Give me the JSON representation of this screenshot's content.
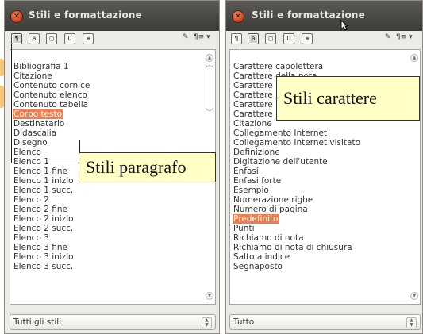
{
  "left_panel": {
    "title": "Stili e formattazione",
    "close_glyph": "×",
    "toolbar_right": "¶≡ ▾",
    "items": [
      "Bibliografia 1",
      "Citazione",
      "Contenuto cornice",
      "Contenuto elenco",
      "Contenuto tabella",
      "Corpo testo",
      "Destinatario",
      "Didascalia",
      "Disegno",
      "Elenco",
      "Elenco 1",
      "Elenco 1 fine",
      "Elenco 1 inizio",
      "Elenco 1 succ.",
      "Elenco 2",
      "Elenco 2 fine",
      "Elenco 2 inizio",
      "Elenco 2 succ.",
      "Elenco 3",
      "Elenco 3 fine",
      "Elenco 3 inizio",
      "Elenco 3 succ."
    ],
    "selected_item": "Corpo testo",
    "filter_value": "Tutti gli stili",
    "callout": "Stili paragrafo"
  },
  "right_panel": {
    "title": "Stili e formattazione",
    "close_glyph": "×",
    "toolbar_right": "¶≡ ▾",
    "items": [
      "Carattere capolettera",
      "Carattere della nota",
      "Carattere",
      "Carattere",
      "Carattere",
      "Carattere",
      "Citazione",
      "Collegamento Internet",
      "Collegamento Internet visitato",
      "Definizione",
      "Digitazione dell'utente",
      "Enfasi",
      "Enfasi forte",
      "Esempio",
      "Numerazione righe",
      "Numero di pagina",
      "Predefinito",
      "Punti",
      "Richiamo di nota",
      "Richiamo di nota di chiusura",
      "Salto a indice",
      "Segnaposto"
    ],
    "selected_item": "Predefinito",
    "filter_value": "Tutto",
    "callout": "Stili carattere"
  },
  "colors": {
    "selection": "#f17d4e",
    "callout_bg": "#ffffc6",
    "titlebar": "#3c3b37"
  },
  "icons": [
    "paragraph-styles-icon",
    "character-styles-icon",
    "frame-styles-icon",
    "page-styles-icon",
    "list-styles-icon",
    "fill-format-icon",
    "new-style-menu-icon"
  ]
}
